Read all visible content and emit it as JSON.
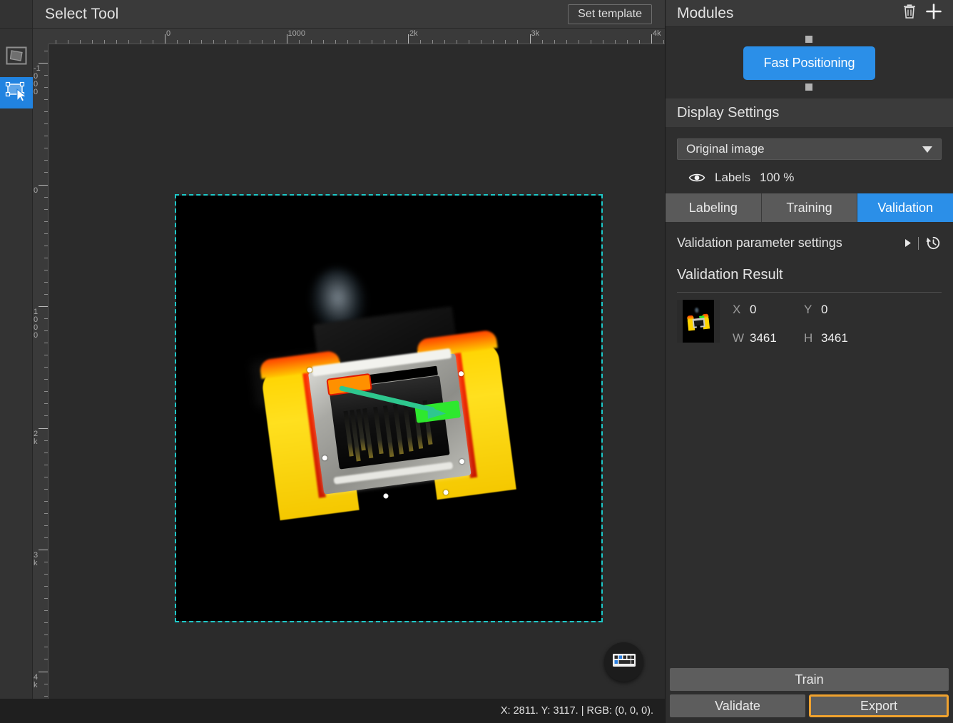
{
  "canvas_header": {
    "tool_title": "Select Tool",
    "set_template_label": "Set template"
  },
  "tool_rail": {
    "items": [
      {
        "name": "polygon-tool",
        "icon": "rotated-square-icon",
        "active": false
      },
      {
        "name": "select-tool",
        "icon": "select-rect-cursor-icon",
        "active": true
      }
    ]
  },
  "rulers": {
    "horizontal_labels": [
      "0",
      "1000",
      "2k",
      "3k",
      "4k"
    ],
    "vertical_labels": [
      "-1000",
      "0",
      "1000",
      "2k",
      "3k",
      "4k"
    ],
    "unit": "px"
  },
  "canvas": {
    "selection": {
      "style": "dashed",
      "color": "#1ec8c8"
    },
    "annotation": {
      "start_box_color": "#ff9000",
      "start_box_border": "#e21b00",
      "end_box_color": "#2ee82e",
      "arrow_color": "#2ec78e",
      "arrow_direction": "left-to-right"
    },
    "keyboard_fab": "keyboard-shortcuts-icon"
  },
  "status_bar": {
    "text": "X: 2811. Y: 3117. | RGB: (0, 0, 0)."
  },
  "modules": {
    "title": "Modules",
    "delete_icon": "trash-icon",
    "add_icon": "plus-icon",
    "nodes": [
      {
        "label": "Fast Positioning",
        "color": "#2b8fe8"
      }
    ]
  },
  "display_settings": {
    "title": "Display Settings",
    "image_mode": "Original image",
    "image_mode_options": [
      "Original image"
    ],
    "labels_label": "Labels",
    "labels_visibility_icon": "eye-icon",
    "labels_opacity": "100 %"
  },
  "tabs": [
    {
      "label": "Labeling",
      "active": false
    },
    {
      "label": "Training",
      "active": false
    },
    {
      "label": "Validation",
      "active": true
    }
  ],
  "validation_parameters": {
    "label": "Validation parameter settings",
    "expand_icon": "triangle-right-icon",
    "reset_icon": "history-reset-icon"
  },
  "validation_result": {
    "title": "Validation Result",
    "items": [
      {
        "thumbnail": "connector-thumbnail",
        "fields": [
          {
            "key": "X",
            "value": "0"
          },
          {
            "key": "Y",
            "value": "0"
          },
          {
            "key": "W",
            "value": "3461"
          },
          {
            "key": "H",
            "value": "3461"
          }
        ]
      }
    ]
  },
  "actions": {
    "train_label": "Train",
    "validate_label": "Validate",
    "export_label": "Export",
    "export_highlight_color": "#f0a22e"
  },
  "theme": {
    "accent": "#2b8fe8",
    "panel_bg": "#2e2e2e",
    "header_bg": "#3a3a3a",
    "canvas_bg": "#2b2b2b",
    "highlight": "#f0a22e"
  }
}
